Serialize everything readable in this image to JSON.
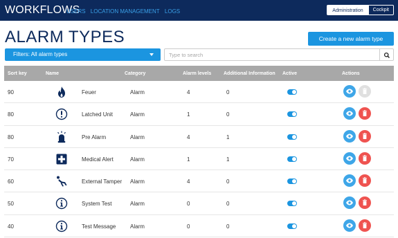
{
  "nav": {
    "brand": "WORKFLOWS",
    "links": [
      "USERS",
      "LOCATION MANAGEMENT",
      "LOGS"
    ],
    "admin_button": "Administration",
    "cockpit_button": "Cockpit"
  },
  "page": {
    "title": "ALARM TYPES",
    "create_button": "Create a new alarm type"
  },
  "filters": {
    "selected": "Filters: All alarm types",
    "search_placeholder": "Type to search"
  },
  "table": {
    "columns": [
      "Sort key",
      "Name",
      "Category",
      "Alarm levels",
      "Additional Information",
      "Active",
      "Actions"
    ],
    "rows": [
      {
        "sort_key": "90",
        "icon": "flame-icon",
        "name": "Feuer",
        "category": "Alarm",
        "alarm_levels": "4",
        "additional_info": "0",
        "active": true,
        "delete_enabled": false
      },
      {
        "sort_key": "80",
        "icon": "exclamation-circle-icon",
        "name": "Latched Unit",
        "category": "Alarm",
        "alarm_levels": "1",
        "additional_info": "0",
        "active": true,
        "delete_enabled": true
      },
      {
        "sort_key": "80",
        "icon": "alarm-light-icon",
        "name": "Pre Alarm",
        "category": "Alarm",
        "alarm_levels": "4",
        "additional_info": "1",
        "active": true,
        "delete_enabled": true
      },
      {
        "sort_key": "70",
        "icon": "medical-cross-icon",
        "name": "Medical Alert",
        "category": "Alarm",
        "alarm_levels": "1",
        "additional_info": "1",
        "active": true,
        "delete_enabled": true
      },
      {
        "sort_key": "60",
        "icon": "falling-person-icon",
        "name": "External Tamper",
        "category": "Alarm",
        "alarm_levels": "4",
        "additional_info": "0",
        "active": true,
        "delete_enabled": true
      },
      {
        "sort_key": "50",
        "icon": "info-circle-icon",
        "name": "System Test",
        "category": "Alarm",
        "alarm_levels": "0",
        "additional_info": "0",
        "active": true,
        "delete_enabled": true
      },
      {
        "sort_key": "40",
        "icon": "info-circle-icon",
        "name": "Test Message",
        "category": "Alarm",
        "alarm_levels": "0",
        "additional_info": "0",
        "active": true,
        "delete_enabled": true
      }
    ]
  },
  "colors": {
    "navbar": "#0d2a5c",
    "primary": "#1b95e0",
    "header_row": "#a8a8a8",
    "delete": "#ef5350"
  }
}
